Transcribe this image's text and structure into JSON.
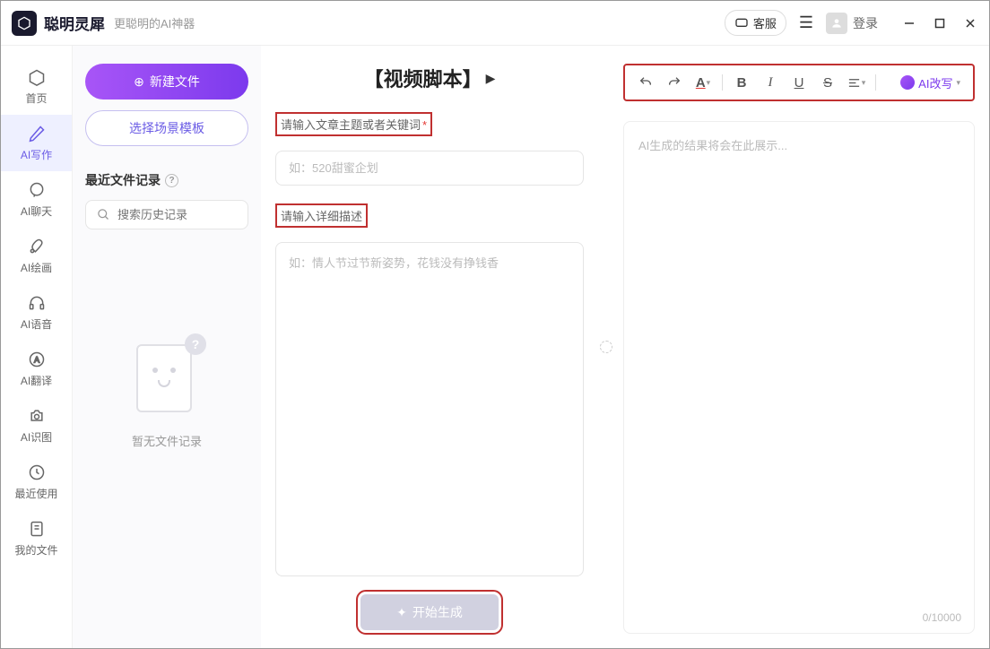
{
  "app": {
    "name": "聪明灵犀",
    "tagline": "更聪明的AI神器"
  },
  "titlebar": {
    "customer_service": "客服",
    "login": "登录"
  },
  "sidebar": {
    "items": [
      {
        "label": "首页"
      },
      {
        "label": "AI写作"
      },
      {
        "label": "AI聊天"
      },
      {
        "label": "AI绘画"
      },
      {
        "label": "AI语音"
      },
      {
        "label": "AI翻译"
      },
      {
        "label": "AI识图"
      },
      {
        "label": "最近使用"
      },
      {
        "label": "我的文件"
      }
    ]
  },
  "file_panel": {
    "new_file": "新建文件",
    "choose_template": "选择场景模板",
    "recent_files": "最近文件记录",
    "search_placeholder": "搜索历史记录",
    "empty_text": "暂无文件记录"
  },
  "input_panel": {
    "title": "【视频脚本】",
    "topic_label": "请输入文章主题或者关键词",
    "topic_placeholder": "如：520甜蜜企划",
    "detail_label": "请输入详细描述",
    "detail_placeholder": "如：情人节过节新姿势，花钱没有挣钱香",
    "generate": "开始生成"
  },
  "output_panel": {
    "ai_rewrite": "AI改写",
    "placeholder": "AI生成的结果将会在此展示...",
    "char_count": "0/10000"
  }
}
